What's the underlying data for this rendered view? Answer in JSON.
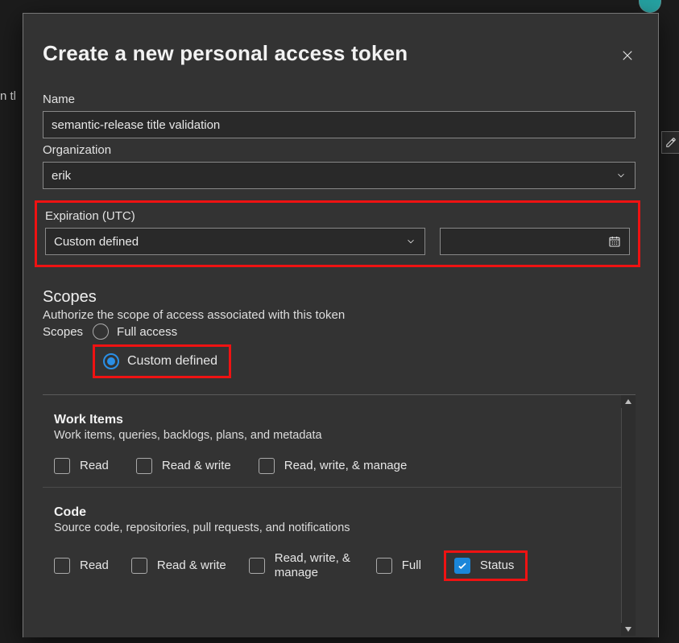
{
  "dialog": {
    "title": "Create a new personal access token"
  },
  "name": {
    "label": "Name",
    "value": "semantic-release title validation"
  },
  "organization": {
    "label": "Organization",
    "value": "erik"
  },
  "expiration": {
    "label": "Expiration (UTC)",
    "value": "Custom defined",
    "date_value": ""
  },
  "scopes": {
    "title": "Scopes",
    "subtitle": "Authorize the scope of access associated with this token",
    "radios_label": "Scopes",
    "full_access": "Full access",
    "custom_defined": "Custom defined"
  },
  "scope_groups": {
    "work_items": {
      "title": "Work Items",
      "desc": "Work items, queries, backlogs, plans, and metadata",
      "read": "Read",
      "read_write": "Read & write",
      "read_write_manage": "Read, write, & manage"
    },
    "code": {
      "title": "Code",
      "desc": "Source code, repositories, pull requests, and notifications",
      "read": "Read",
      "read_write": "Read & write",
      "read_write_manage": "Read, write, & manage",
      "full": "Full",
      "status": "Status"
    }
  },
  "bg": {
    "sidebar_text": "n tl"
  }
}
